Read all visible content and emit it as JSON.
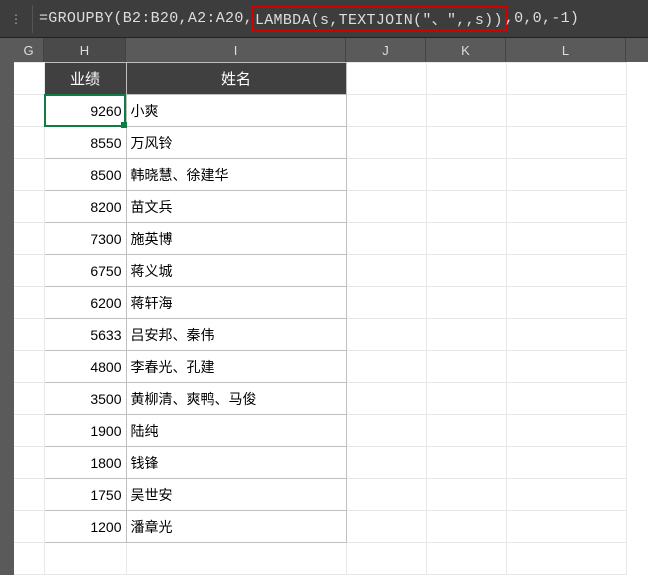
{
  "formula": {
    "prefix": "=GROUPBY(B2:B20,A2:A20,",
    "highlight": "LAMBDA(s,TEXTJOIN(\"、\",,s))",
    "suffix": ",0,0,-1)"
  },
  "columns": {
    "G": "G",
    "H": "H",
    "I": "I",
    "J": "J",
    "K": "K",
    "L": "L"
  },
  "table": {
    "headers": {
      "h": "业绩",
      "i": "姓名"
    },
    "rows": [
      {
        "h": "9260",
        "i": "小爽"
      },
      {
        "h": "8550",
        "i": "万风铃"
      },
      {
        "h": "8500",
        "i": "韩晓慧、徐建华"
      },
      {
        "h": "8200",
        "i": "苗文兵"
      },
      {
        "h": "7300",
        "i": "施英博"
      },
      {
        "h": "6750",
        "i": "蒋义城"
      },
      {
        "h": "6200",
        "i": "蒋轩海"
      },
      {
        "h": "5633",
        "i": "吕安邦、秦伟"
      },
      {
        "h": "4800",
        "i": "李春光、孔建"
      },
      {
        "h": "3500",
        "i": "黄柳清、爽鸭、马俊"
      },
      {
        "h": "1900",
        "i": "陆纯"
      },
      {
        "h": "1800",
        "i": "钱锋"
      },
      {
        "h": "1750",
        "i": "吴世安"
      },
      {
        "h": "1200",
        "i": "潘章光"
      }
    ]
  }
}
